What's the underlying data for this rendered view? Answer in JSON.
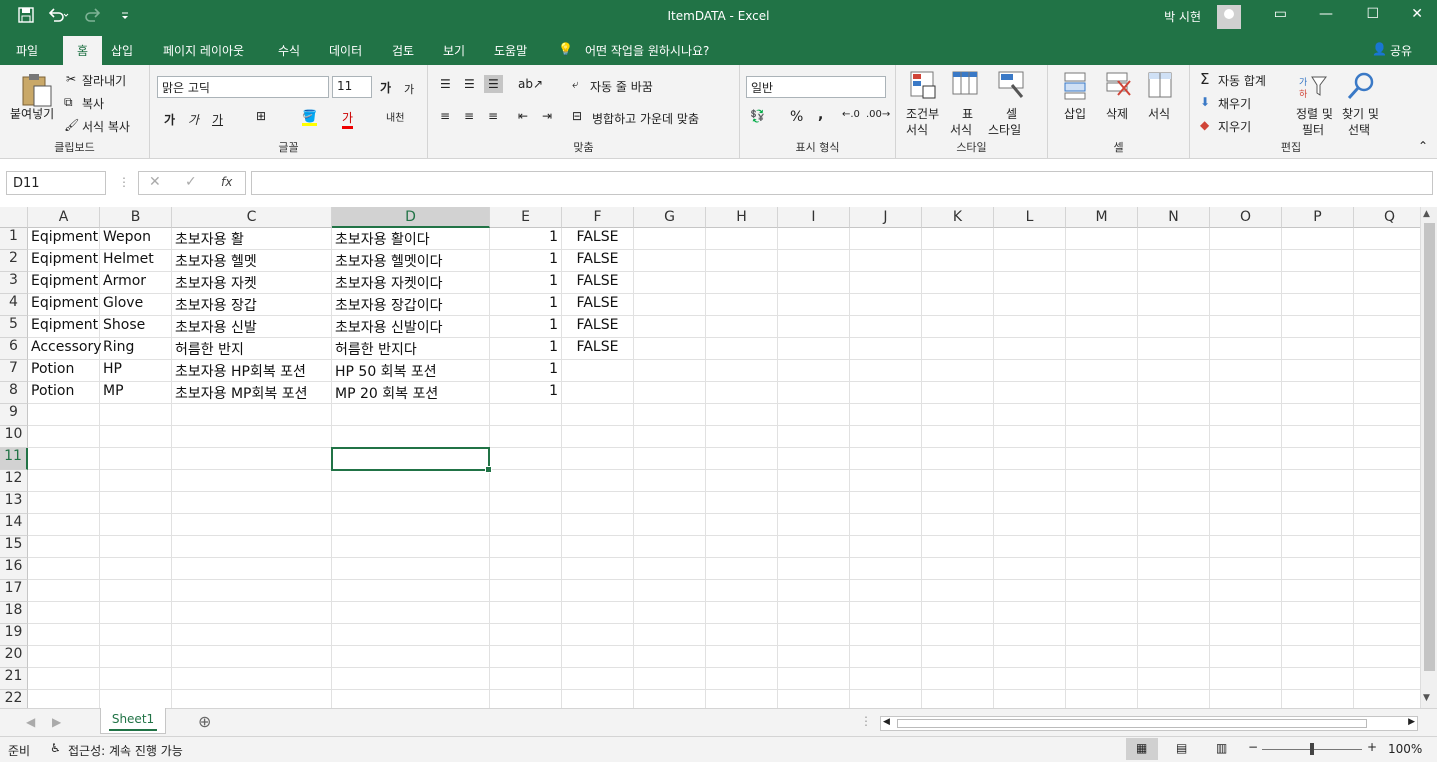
{
  "app": {
    "title": "ItemDATA  -  Excel",
    "user": "박 시현",
    "accent": "#217346"
  },
  "tabs": [
    {
      "label": "파일"
    },
    {
      "label": "홈"
    },
    {
      "label": "삽입"
    },
    {
      "label": "페이지 레이아웃"
    },
    {
      "label": "수식"
    },
    {
      "label": "데이터"
    },
    {
      "label": "검토"
    },
    {
      "label": "보기"
    },
    {
      "label": "도움말"
    }
  ],
  "tell_me": "어떤 작업을 원하시나요?",
  "share": "공유",
  "ribbon": {
    "clipboard": {
      "paste": "붙여넣기",
      "cut": "잘라내기",
      "copy": "복사",
      "format_painter": "서식 복사",
      "label": "클립보드"
    },
    "font": {
      "name": "맑은 고딕",
      "size": "11",
      "label": "글꼴",
      "bold": "가",
      "italic": "가",
      "underline": "가",
      "phonetic": "내천"
    },
    "alignment": {
      "wrap": "자동 줄 바꿈",
      "merge": "병합하고 가운데 맞춤",
      "label": "맞춤"
    },
    "number": {
      "format": "일반",
      "percent": "%",
      "comma": ",",
      "label": "표시 형식"
    },
    "styles": {
      "conditional": "조건부\n서식",
      "table": "표\n서식",
      "cell": "셀\n스타일",
      "label": "스타일",
      "cond_l1": "조건부",
      "cond_l2": "서식",
      "table_l1": "표",
      "table_l2": "서식",
      "cell_l1": "셀",
      "cell_l2": "스타일"
    },
    "cells": {
      "insert": "삽입",
      "delete": "삭제",
      "format": "서식",
      "label": "셀"
    },
    "editing": {
      "autosum": "자동 합계",
      "fill": "채우기",
      "clear": "지우기",
      "sort_l1": "정렬 및",
      "sort_l2": "필터",
      "find_l1": "찾기 및",
      "find_l2": "선택",
      "label": "편집"
    }
  },
  "name_box": "D11",
  "fx": "fx",
  "columns": [
    "A",
    "B",
    "C",
    "D",
    "E",
    "F",
    "G",
    "H",
    "I",
    "J",
    "K",
    "L",
    "M",
    "N",
    "O",
    "P",
    "Q"
  ],
  "rows": [
    [
      "Eqipment",
      "Wepon",
      "초보자용 활",
      "초보자용 활이다",
      "1",
      "FALSE"
    ],
    [
      "Eqipment",
      "Helmet",
      "초보자용 헬멧",
      "초보자용 헬멧이다",
      "1",
      "FALSE"
    ],
    [
      "Eqipment",
      "Armor",
      "초보자용 자켓",
      "초보자용 자켓이다",
      "1",
      "FALSE"
    ],
    [
      "Eqipment",
      "Glove",
      "초보자용 장갑",
      "초보자용 장갑이다",
      "1",
      "FALSE"
    ],
    [
      "Eqipment",
      "Shose",
      "초보자용 신발",
      "초보자용 신발이다",
      "1",
      "FALSE"
    ],
    [
      "Accessory",
      "Ring",
      "허름한 반지",
      "허름한 반지다",
      "1",
      "FALSE"
    ],
    [
      "Potion",
      "HP",
      "초보자용 HP회복 포션",
      "HP 50 회복 포션",
      "1",
      ""
    ],
    [
      "Potion",
      "MP",
      "초보자용 MP회복 포션",
      "MP 20 회복 포션",
      "1",
      ""
    ]
  ],
  "row_numbers": [
    "1",
    "2",
    "3",
    "4",
    "5",
    "6",
    "7",
    "8",
    "9",
    "10",
    "11",
    "12",
    "13",
    "14",
    "15",
    "16",
    "17",
    "18",
    "19",
    "20",
    "21",
    "22"
  ],
  "selected": {
    "col": "D",
    "row": "11"
  },
  "sheet": {
    "name": "Sheet1"
  },
  "status": {
    "ready": "준비",
    "accessibility": "접근성: 계속 진행 가능",
    "zoom": "100%",
    "zoom_fraction": 0.5
  }
}
